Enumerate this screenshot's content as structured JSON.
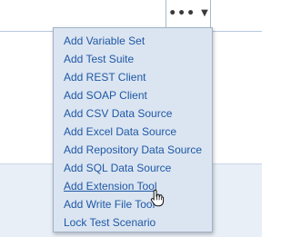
{
  "toolbar": {
    "more_dots": "•••",
    "more_caret": "▼"
  },
  "menu": {
    "items": [
      {
        "label": "Add Variable Set"
      },
      {
        "label": "Add Test Suite"
      },
      {
        "label": "Add REST Client"
      },
      {
        "label": "Add SOAP Client"
      },
      {
        "label": "Add CSV Data Source"
      },
      {
        "label": "Add Excel Data Source"
      },
      {
        "label": "Add Repository Data Source"
      },
      {
        "label": "Add SQL Data Source"
      },
      {
        "label": "Add Extension Tool"
      },
      {
        "label": "Add Write File Tool"
      },
      {
        "label": "Lock Test Scenario"
      }
    ],
    "hovered_item": "Add Extension Tool"
  },
  "colors": {
    "menu_background": "#dbe5f1",
    "menu_text": "#1f58a6",
    "menu_border": "#9fb1c8",
    "lower_band": "#e9eff7"
  },
  "icons": {
    "more_button": "ellipsis-icon",
    "caret": "caret-down-icon",
    "cursor": "hand-pointer-icon"
  }
}
